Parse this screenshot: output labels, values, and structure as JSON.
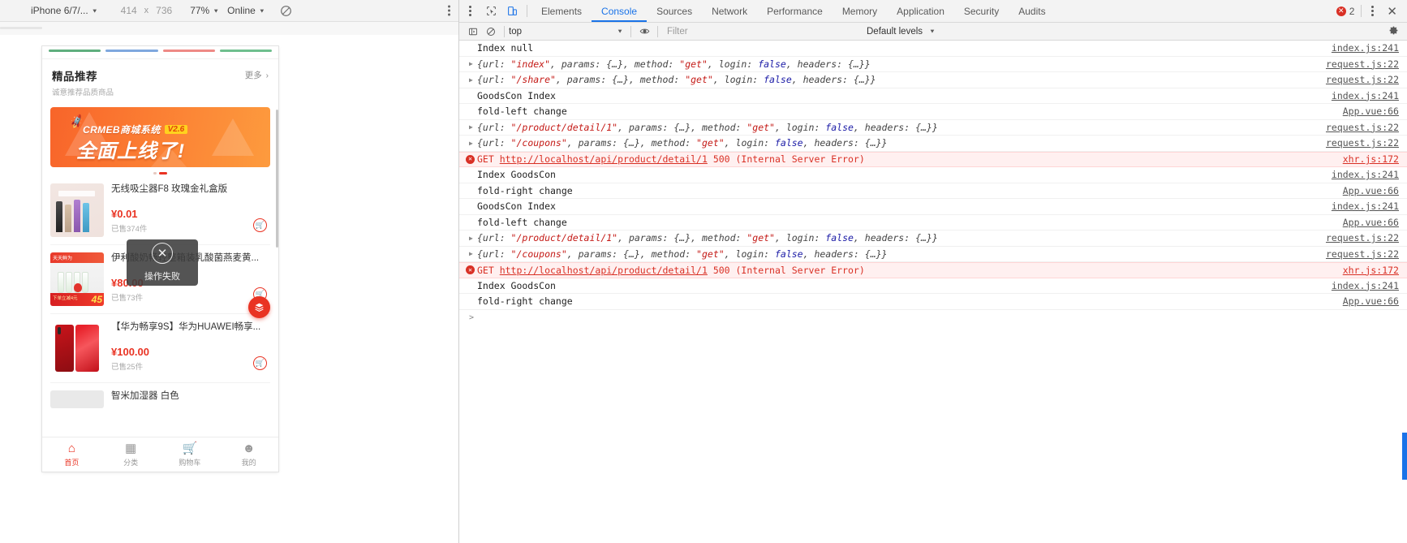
{
  "device_toolbar": {
    "device": "iPhone 6/7/...",
    "width": "414",
    "x_label": "x",
    "height": "736",
    "zoom": "77%",
    "network": "Online",
    "throttle_icon": "no-throttling-icon",
    "menu_icon": "kebab-menu-icon"
  },
  "mobile": {
    "section": {
      "title": "精品推荐",
      "subtitle": "诚意推荐品质商品",
      "more": "更多",
      "chevron": "›"
    },
    "banner": {
      "brand": "CRMEB商城系统",
      "version": "V2.6",
      "headline": "全面上线了!"
    },
    "products": [
      {
        "name": "无线吸尘器F8 玫瑰金礼盒版",
        "price": "¥0.01",
        "sold": "已售374件",
        "thumb": "vacuum-thumb"
      },
      {
        "name": "伊利酸奶畅轻整箱装乳酸菌燕麦黄...",
        "price": "¥80.00",
        "sold": "已售73件",
        "thumb": "milk-thumb"
      },
      {
        "name": "【华为畅享9S】华为HUAWEI畅享...",
        "price": "¥100.00",
        "sold": "已售25件",
        "thumb": "phone-thumb"
      },
      {
        "name": "智米加湿器 白色",
        "price": "",
        "sold": "",
        "thumb": "humidifier-thumb"
      }
    ],
    "toast": {
      "message": "操作失败",
      "icon": "close-circle-icon"
    },
    "fab": {
      "icon": "menu-stack-icon"
    },
    "tabbar": [
      {
        "label": "首页",
        "icon": "home-icon",
        "active": true
      },
      {
        "label": "分类",
        "icon": "grid-icon",
        "active": false
      },
      {
        "label": "购物车",
        "icon": "cart-icon",
        "active": false
      },
      {
        "label": "我的",
        "icon": "person-icon",
        "active": false
      }
    ]
  },
  "devtools": {
    "inspect_icon": "inspect-cursor-icon",
    "device_icon": "device-toolbar-icon",
    "tabs": [
      "Elements",
      "Console",
      "Sources",
      "Network",
      "Performance",
      "Memory",
      "Application",
      "Security",
      "Audits"
    ],
    "selected_tab": "Console",
    "error_count": "2",
    "more_icon": "kebab-menu-icon",
    "close_icon": "close-icon",
    "filterbar": {
      "sidebar_icon": "console-sidebar-icon",
      "clear_icon": "clear-console-icon",
      "context": "top",
      "eye_icon": "live-expression-icon",
      "filter_placeholder": "Filter",
      "levels": "Default levels",
      "settings_icon": "gear-icon"
    },
    "prompt_arrow": ">",
    "log": [
      {
        "type": "log",
        "expand": false,
        "text": "Index null",
        "source": "index.js:241"
      },
      {
        "type": "object",
        "expand": true,
        "url": "\"index\"",
        "method": "\"get\"",
        "login": "false",
        "source": "request.js:22"
      },
      {
        "type": "object",
        "expand": true,
        "url": "\"/share\"",
        "method": "\"get\"",
        "login": "false",
        "source": "request.js:22"
      },
      {
        "type": "log",
        "expand": false,
        "text": "GoodsCon Index",
        "source": "index.js:241"
      },
      {
        "type": "log",
        "expand": false,
        "text": "fold-left change",
        "source": "App.vue:66"
      },
      {
        "type": "object",
        "expand": true,
        "url": "\"/product/detail/1\"",
        "method": "\"get\"",
        "login": "false",
        "source": "request.js:22"
      },
      {
        "type": "object",
        "expand": true,
        "url": "\"/coupons\"",
        "method": "\"get\"",
        "login": "false",
        "source": "request.js:22"
      },
      {
        "type": "error",
        "expand": true,
        "prefix": "GET",
        "url_text": "http://localhost/api/product/detail/1",
        "suffix": "500 (Internal Server Error)",
        "source": "xhr.js:172"
      },
      {
        "type": "log",
        "expand": false,
        "text": "Index GoodsCon",
        "source": "index.js:241"
      },
      {
        "type": "log",
        "expand": false,
        "text": "fold-right change",
        "source": "App.vue:66"
      },
      {
        "type": "log",
        "expand": false,
        "text": "GoodsCon Index",
        "source": "index.js:241"
      },
      {
        "type": "log",
        "expand": false,
        "text": "fold-left change",
        "source": "App.vue:66"
      },
      {
        "type": "object",
        "expand": true,
        "url": "\"/product/detail/1\"",
        "method": "\"get\"",
        "login": "false",
        "source": "request.js:22"
      },
      {
        "type": "object",
        "expand": true,
        "url": "\"/coupons\"",
        "method": "\"get\"",
        "login": "false",
        "source": "request.js:22"
      },
      {
        "type": "error",
        "expand": true,
        "prefix": "GET",
        "url_text": "http://localhost/api/product/detail/1",
        "suffix": "500 (Internal Server Error)",
        "source": "xhr.js:172"
      },
      {
        "type": "log",
        "expand": false,
        "text": "Index GoodsCon",
        "source": "index.js:241"
      },
      {
        "type": "log",
        "expand": false,
        "text": "fold-right change",
        "source": "App.vue:66"
      }
    ],
    "object_parts": {
      "open": "{url: ",
      "params": ", params: {…}, method: ",
      "login": ", login: ",
      "tail": ", headers: {…}}"
    }
  },
  "colors": {
    "accent": "#e93323",
    "error": "#d93025",
    "link": "#1a73e8"
  }
}
